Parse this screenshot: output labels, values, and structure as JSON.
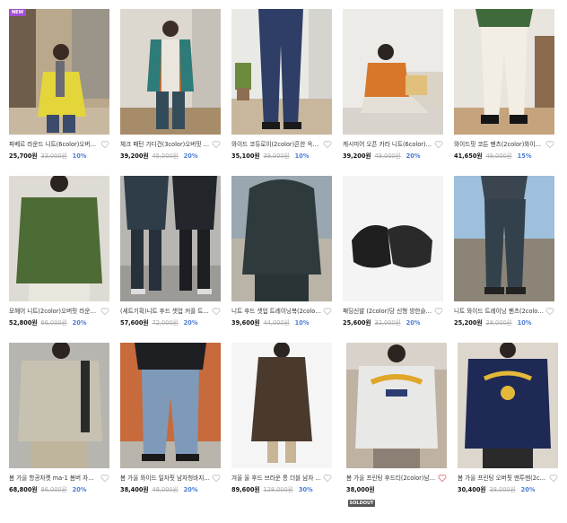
{
  "badges": {
    "new": "NEW",
    "soldout": "SOLDOUT"
  },
  "colors": {
    "discount": "#4a7bd3",
    "new_badge": "#a24ed8",
    "liked_heart": "#e06070"
  },
  "products": [
    {
      "name": "파베르 라운드 니트(6color)오버핏 ...",
      "price": "25,700원",
      "orig": "33,000원",
      "disc": "10%"
    },
    {
      "name": "체크 패턴 가디건(3color)오버핏 울...",
      "price": "39,200원",
      "orig": "45,000원",
      "disc": "20%"
    },
    {
      "name": "와이드 코듀로이(2color)흔한 옥정 ...",
      "price": "35,100원",
      "orig": "39,000원",
      "disc": "10%"
    },
    {
      "name": "캐시미어 오픈 카라 니트(6color)무...",
      "price": "39,200원",
      "orig": "49,000원",
      "disc": "20%"
    },
    {
      "name": "와이드핏 코튼 팬츠(2color)와이드 ...",
      "price": "41,650원",
      "orig": "49,000원",
      "disc": "15%"
    },
    {
      "name": "모헤어 니트(2color)오버핏 라운드 ...",
      "price": "52,800원",
      "orig": "66,000원",
      "disc": "20%"
    },
    {
      "name": "(세트기획)니트 후드 셋업 커플 트...",
      "price": "57,600원",
      "orig": "72,000원",
      "disc": "20%"
    },
    {
      "name": "니트 후드 셋업 트레이닝복(2color)...",
      "price": "39,600원",
      "orig": "44,000원",
      "disc": "10%"
    },
    {
      "name": "패딩신발 (2color)당 신형 방한슬리...",
      "price": "25,600원",
      "orig": "32,000원",
      "disc": "20%"
    },
    {
      "name": "니트 와이드 트레이닝 팬츠(2color)...",
      "price": "25,200원",
      "orig": "28,000원",
      "disc": "10%"
    },
    {
      "name": "봄 가을 항공자켓 ma-1 봄버 자켓(...",
      "price": "68,800원",
      "orig": "86,000원",
      "disc": "20%"
    },
    {
      "name": "봄 가을 와이드 일자핏 남자청바지 ...",
      "price": "38,400원",
      "orig": "48,000원",
      "disc": "20%"
    },
    {
      "name": "겨울 울 후드 브라운 롱 더블 남자 ...",
      "price": "89,600원",
      "orig": "128,000원",
      "disc": "30%"
    },
    {
      "name": "봄 가을 프린팅 후드티(2color)남자...",
      "price": "38,000원",
      "orig": "",
      "disc": ""
    },
    {
      "name": "봄 가을 프린팅 오버핏 맨투맨(2col...",
      "price": "30,400원",
      "orig": "38,000원",
      "disc": "20%"
    }
  ]
}
